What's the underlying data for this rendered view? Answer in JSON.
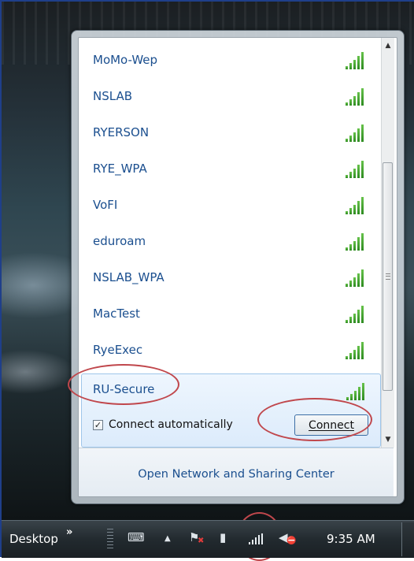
{
  "networks": [
    {
      "name": "MoMo-Wep"
    },
    {
      "name": "NSLAB"
    },
    {
      "name": "RYERSON"
    },
    {
      "name": "RYE_WPA"
    },
    {
      "name": "VoFI"
    },
    {
      "name": "eduroam"
    },
    {
      "name": "NSLAB_WPA"
    },
    {
      "name": "MacTest"
    },
    {
      "name": "RyeExec"
    }
  ],
  "selected_network": {
    "name": "RU-Secure",
    "connect_automatically_label": "Connect automatically",
    "connect_automatically_checked": true,
    "connect_button_label": "Connect"
  },
  "footer": {
    "link_label": "Open Network and Sharing Center"
  },
  "taskbar": {
    "desktop_label": "Desktop",
    "overflow_chevron": "»",
    "time": "9:35 AM"
  },
  "icons": {
    "signal": "wifi-signal-icon",
    "scroll_up": "▲",
    "scroll_down": "▼",
    "check_mark": "✓",
    "tray_arrow": "▲"
  },
  "colors": {
    "link_blue": "#1b4f8f",
    "signal_green": "#2e8b21",
    "annotation_red": "#c0474c",
    "selection_bg": "#dcebfb"
  }
}
